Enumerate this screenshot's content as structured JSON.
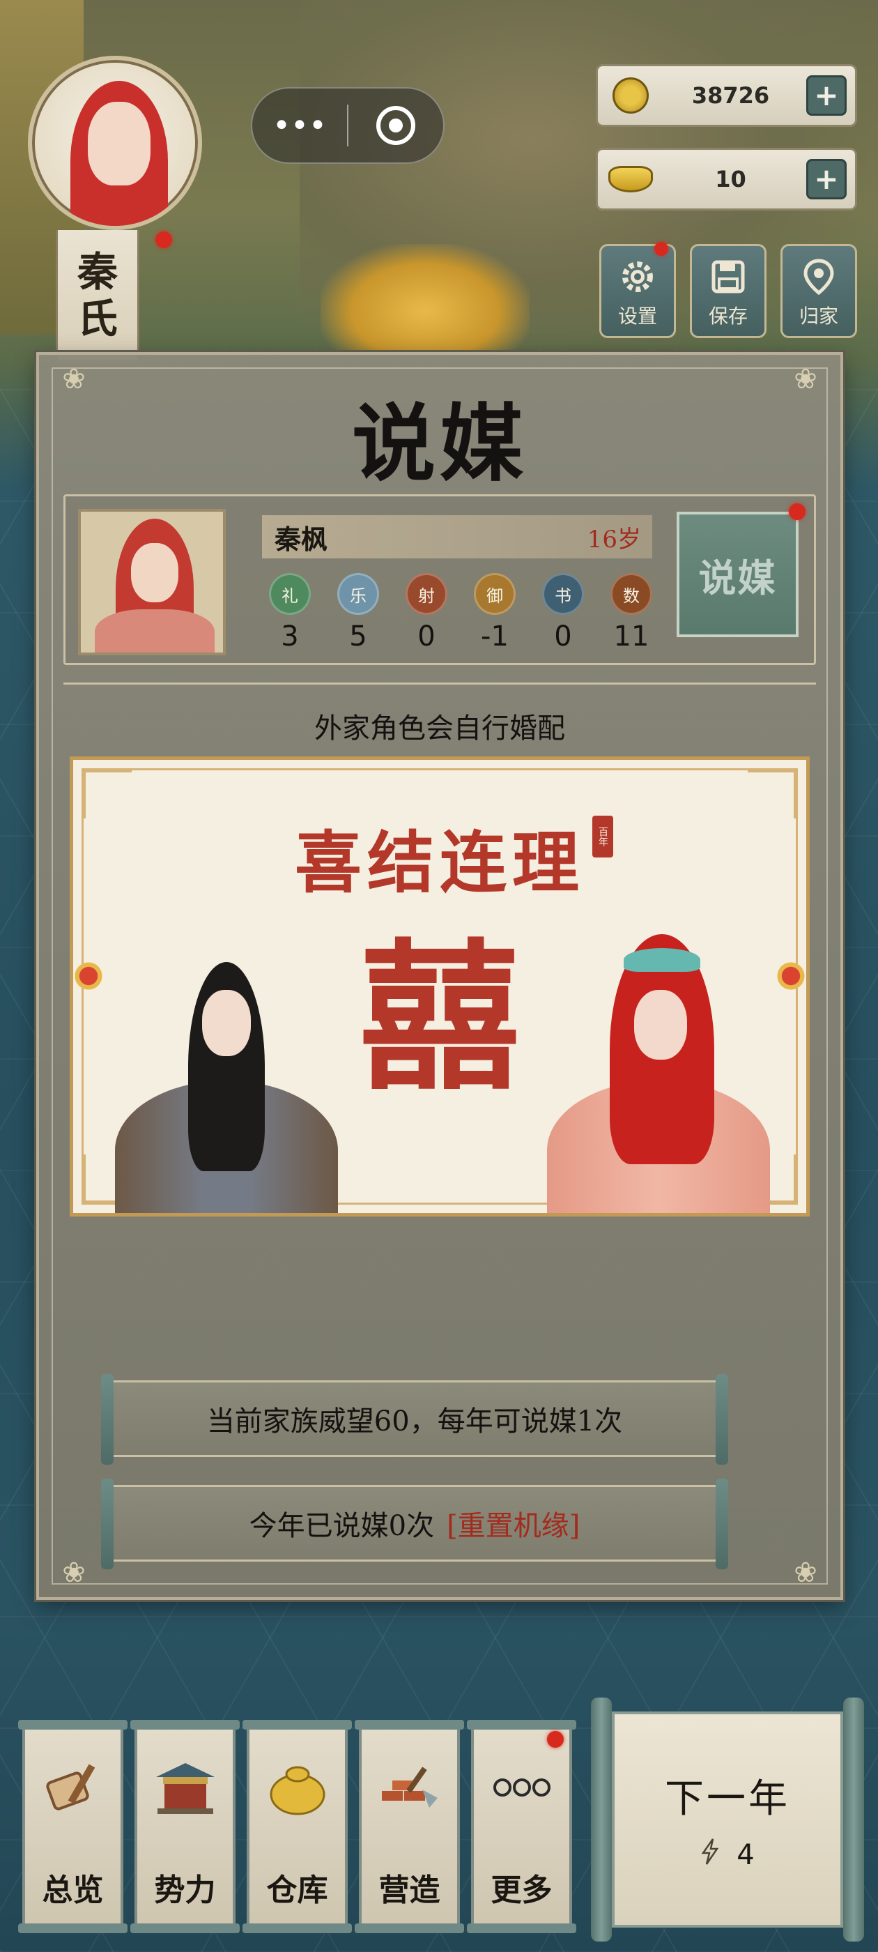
{
  "character": {
    "name_line1": "秦",
    "name_line2": "氏"
  },
  "capsule": {
    "more_glyph": "•••"
  },
  "resources": {
    "coins": "38726",
    "gold": "10",
    "plus_symbol": "+"
  },
  "top_buttons": [
    {
      "label": "设置",
      "icon": "gear-icon"
    },
    {
      "label": "保存",
      "icon": "floppy-icon"
    },
    {
      "label": "归家",
      "icon": "map-pin-icon"
    }
  ],
  "dialog": {
    "title": "说媒",
    "candidate": {
      "name": "秦枫",
      "age": "16岁",
      "attributes": [
        {
          "name": "礼",
          "value": "3",
          "color": "#4f8a5e"
        },
        {
          "name": "乐",
          "value": "5",
          "color": "#6f93a8"
        },
        {
          "name": "射",
          "value": "0",
          "color": "#9a4a2c"
        },
        {
          "name": "御",
          "value": "-1",
          "color": "#a7782e"
        },
        {
          "name": "书",
          "value": "0",
          "color": "#3f5f72"
        },
        {
          "name": "数",
          "value": "11",
          "color": "#8a4a24"
        }
      ],
      "match_button": "说媒"
    },
    "info_text": "外家角色会自行婚配",
    "wedding_card": {
      "title": "喜结连理",
      "seal": "百年",
      "double_happiness": "囍"
    },
    "prestige_text": "当前家族威望60，每年可说媒1次",
    "used_text": "今年已说媒0次",
    "reset_link": "[重置机缘]"
  },
  "bottom_nav": [
    {
      "label": "总览",
      "icon": "scroll-brush-icon"
    },
    {
      "label": "势力",
      "icon": "pavilion-icon"
    },
    {
      "label": "仓库",
      "icon": "sack-icon"
    },
    {
      "label": "营造",
      "icon": "bricks-trowel-icon"
    },
    {
      "label": "更多",
      "icon": "more-dots-icon"
    }
  ],
  "next_year": {
    "label": "下一年",
    "energy": "4"
  },
  "colors": {
    "accent_red": "#b3382a",
    "teal": "#5a7a6e",
    "parchment": "#f5efe1"
  }
}
